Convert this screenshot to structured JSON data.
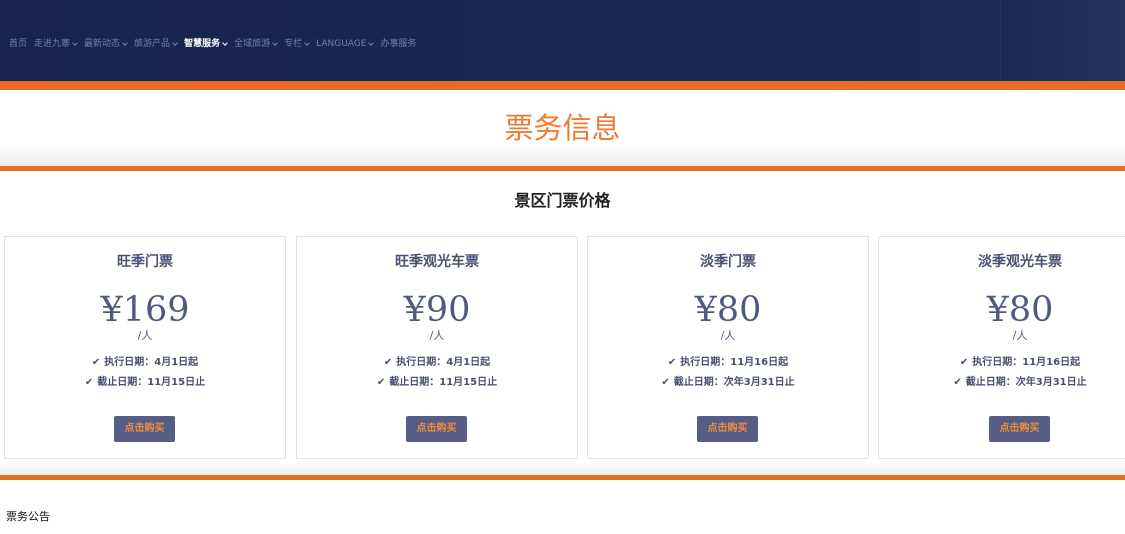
{
  "nav": {
    "items": [
      {
        "label": "首页",
        "has_dropdown": false,
        "active": false
      },
      {
        "label": "走进九寨",
        "has_dropdown": true,
        "active": false
      },
      {
        "label": "最新动态",
        "has_dropdown": true,
        "active": false
      },
      {
        "label": "旅游产品",
        "has_dropdown": true,
        "active": false
      },
      {
        "label": "智慧服务",
        "has_dropdown": true,
        "active": true
      },
      {
        "label": "全域旅游",
        "has_dropdown": true,
        "active": false
      },
      {
        "label": "专栏",
        "has_dropdown": true,
        "active": false
      },
      {
        "label": "LANGUAGE",
        "has_dropdown": true,
        "active": false
      },
      {
        "label": "办事服务",
        "has_dropdown": false,
        "active": false
      }
    ]
  },
  "page": {
    "title": "票务信息",
    "section_title": "景区门票价格",
    "notice_title": "票务公告"
  },
  "cards": [
    {
      "name": "旺季门票",
      "price": "¥169",
      "unit": "/人",
      "start": "执行日期：4月1日起",
      "end": "截止日期：11月15日止",
      "button": "点击购买"
    },
    {
      "name": "旺季观光车票",
      "price": "¥90",
      "unit": "/人",
      "start": "执行日期：4月1日起",
      "end": "截止日期：11月15日止",
      "button": "点击购买"
    },
    {
      "name": "淡季门票",
      "price": "¥80",
      "unit": "/人",
      "start": "执行日期：11月16日起",
      "end": "截止日期：次年3月31日止",
      "button": "点击购买"
    },
    {
      "name": "淡季观光车票",
      "price": "¥80",
      "unit": "/人",
      "start": "执行日期：11月16日起",
      "end": "截止日期：次年3月31日止",
      "button": "点击购买"
    }
  ],
  "icons": {
    "check": "check-icon",
    "dropdown": "chevron-down-icon"
  },
  "colors": {
    "nav_background": "#17254d",
    "accent_orange": "#e76c25",
    "title_orange": "#ee7a34",
    "card_text": "#505a7f",
    "button_background": "#565e85",
    "button_text": "#f08a3c"
  }
}
